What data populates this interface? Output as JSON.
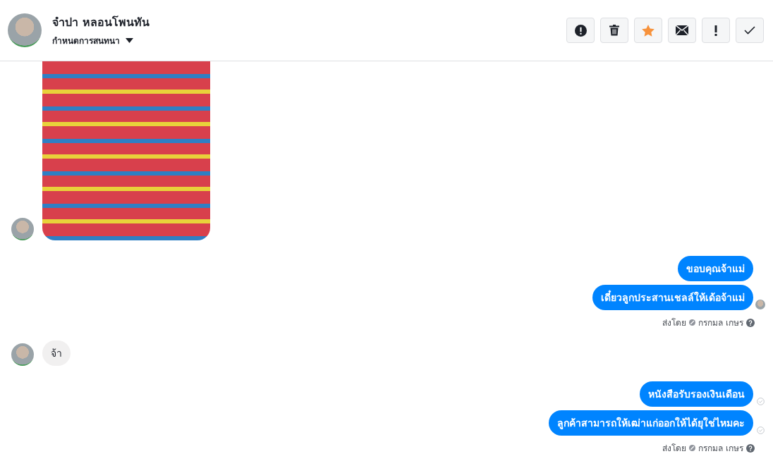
{
  "header": {
    "name": "จำปา หลอนโพนทัน",
    "menu_label": "กำหนดการสนทนา"
  },
  "actions": [
    {
      "kind": "alert"
    },
    {
      "kind": "trash"
    },
    {
      "kind": "star",
      "active": true
    },
    {
      "kind": "mail"
    },
    {
      "kind": "exclaim"
    },
    {
      "kind": "check"
    }
  ],
  "groups": [
    {
      "outgoing": false,
      "messages": [
        {
          "kind": "image"
        }
      ]
    },
    {
      "outgoing": true,
      "messages": [
        {
          "text": "ขอบคุณจ้าแม่",
          "seen": false,
          "sent": false
        },
        {
          "text": "เดี๋ยวลูกประสานเชลล์ให้เด้อจ้าแม่",
          "seen": true,
          "sent": false
        }
      ],
      "sent_by_label": "ส่งโดย",
      "sent_by_name": "กรกมล เกษร"
    },
    {
      "outgoing": false,
      "messages": [
        {
          "kind": "text",
          "text": "จ้า"
        }
      ]
    },
    {
      "outgoing": true,
      "messages": [
        {
          "text": "หนังสือรับรองเงินเดือน",
          "seen": false,
          "sent": true
        },
        {
          "text": "ลูกค้าสามารถให้เฒ่าแก่ออกให้ได้ยุใช่ไหมคะ",
          "seen": false,
          "sent": true
        }
      ],
      "sent_by_label": "ส่งโดย",
      "sent_by_name": "กรกมล เกษร"
    }
  ]
}
